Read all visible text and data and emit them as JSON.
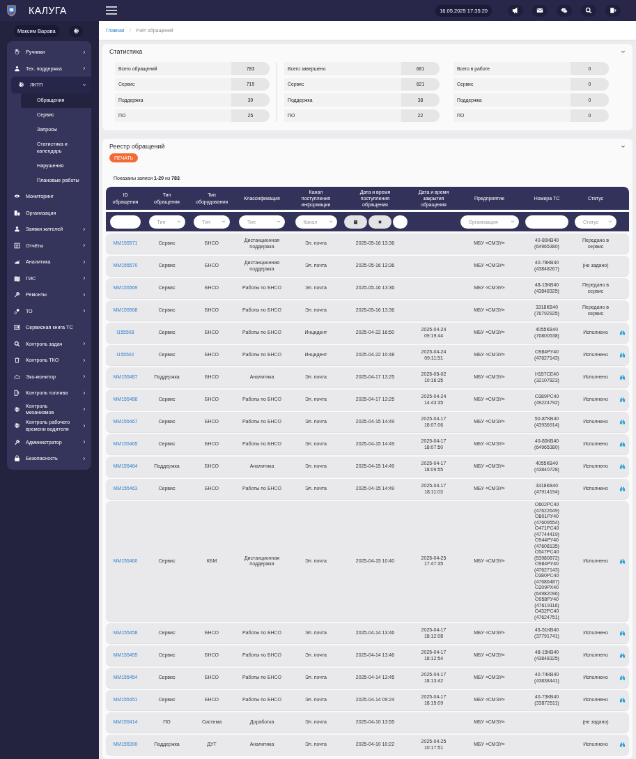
{
  "app": {
    "title": "КАЛУГА",
    "datetime": "16.05.2025 17:35:20"
  },
  "user": {
    "name": "Максим Варава"
  },
  "menu": [
    {
      "label": "Ручники",
      "submenu": true,
      "expanded": false
    },
    {
      "label": "Тех. поддержка",
      "submenu": true,
      "expanded": false
    },
    {
      "label": "ЛКТП",
      "submenu": true,
      "expanded": true,
      "children": [
        {
          "label": "Обращения",
          "selected": true
        },
        {
          "label": "Сервис",
          "selected": false
        },
        {
          "label": "Запросы",
          "selected": false
        },
        {
          "label": "Статистика и календарь",
          "selected": false
        },
        {
          "label": "Нарушения",
          "selected": false
        },
        {
          "label": "Плановые работы",
          "selected": false
        }
      ]
    },
    {
      "label": "Мониторинг",
      "submenu": false
    },
    {
      "label": "Организации",
      "submenu": false
    },
    {
      "label": "Заявки жителей",
      "submenu": true,
      "expanded": false
    },
    {
      "label": "Отчёты",
      "submenu": true,
      "expanded": false
    },
    {
      "label": "Аналитика",
      "submenu": true,
      "expanded": false
    },
    {
      "label": "ГИС",
      "submenu": true,
      "expanded": false
    },
    {
      "label": "Ремонты",
      "submenu": true,
      "expanded": false
    },
    {
      "label": "ТО",
      "submenu": true,
      "expanded": false
    },
    {
      "label": "Сервисная книга ТС",
      "submenu": false
    },
    {
      "label": "Контроль задач",
      "submenu": true,
      "expanded": false
    },
    {
      "label": "Контроль ТКО",
      "submenu": true,
      "expanded": false
    },
    {
      "label": "Эко-монитор",
      "submenu": true,
      "expanded": false
    },
    {
      "label": "Контроль топлива",
      "submenu": true,
      "expanded": false
    },
    {
      "label": "Контроль механизмов",
      "submenu": true,
      "expanded": false
    },
    {
      "label": "Контроль рабочего времени водителя",
      "submenu": true,
      "expanded": false
    },
    {
      "label": "Администратор",
      "submenu": true,
      "expanded": false
    },
    {
      "label": "Безопасность",
      "submenu": true,
      "expanded": false
    }
  ],
  "breadcrumb_separator": "/",
  "breadcrumbs": [
    {
      "label": "Главная",
      "link": true
    },
    {
      "label": "Учёт обращений",
      "link": false
    }
  ],
  "statistics": {
    "title": "Статистика",
    "groups": [
      [
        {
          "label": "Всего обращений",
          "value": "783"
        },
        {
          "label": "Сервис",
          "value": "719"
        },
        {
          "label": "Поддержка",
          "value": "39"
        },
        {
          "label": "ПО",
          "value": "25"
        }
      ],
      [
        {
          "label": "Всего завершено",
          "value": "681"
        },
        {
          "label": "Сервис",
          "value": "621"
        },
        {
          "label": "Поддержка",
          "value": "38"
        },
        {
          "label": "ПО",
          "value": "22"
        }
      ],
      [
        {
          "label": "Всего в работе",
          "value": "0"
        },
        {
          "label": "Сервис",
          "value": "0"
        },
        {
          "label": "Поддержка",
          "value": "0"
        },
        {
          "label": "ПО",
          "value": "0"
        }
      ]
    ]
  },
  "registry": {
    "title": "Реестр обращений",
    "print_button": "ПЕЧАТЬ",
    "summary": "Показаны записи **1-20** из **783**.",
    "columns": [
      "ID обращения",
      "Тип обращения",
      "Тип оборудования",
      "Классификация",
      "Канал поступления информации",
      "Дата и время поступления обращения",
      "Дата и время закрытия обращения",
      "Предприятие",
      "Номера ТС",
      "Статус"
    ],
    "filters": {
      "type": "Тип",
      "equipment": "Тип",
      "classification": "Тип",
      "channel": "Канал",
      "organization": "Организация",
      "status": "Статус"
    },
    "rows": [
      {
        "id": "MM155571",
        "type": "Сервис",
        "equipment": "БНСО",
        "classification": "Дистанционная поддержка",
        "channel": "Эл. почта",
        "received": "2025-05-16 13:36",
        "closed": "",
        "organization": "МБУ «СМЭУ»",
        "plates": [
          "40-80КВ40",
          "(64965380)"
        ],
        "status": "Передано в сервис",
        "view": false
      },
      {
        "id": "MM155570",
        "type": "Сервис",
        "equipment": "БНСО",
        "classification": "Дистанционная поддержка",
        "channel": "Эл. почта",
        "received": "2025-05-16 13:36",
        "closed": "",
        "organization": "МБУ «СМЭУ»",
        "plates": [
          "40-78КВ40",
          "(43848267)"
        ],
        "status": "(не задано)",
        "view": false
      },
      {
        "id": "MM155569",
        "type": "Сервис",
        "equipment": "БНСО",
        "classification": "Работы по БНСО",
        "channel": "Эл. почта",
        "received": "2025-05-16 13:36",
        "closed": "",
        "organization": "МБУ «СМЭУ»",
        "plates": [
          "48-15КВ40",
          "(43848325)"
        ],
        "status": "Передано в сервис",
        "view": false
      },
      {
        "id": "MM155568",
        "type": "Сервис",
        "equipment": "БНСО",
        "classification": "Работы по БНСО",
        "channel": "Эл. почта",
        "received": "2025-05-16 13:36",
        "closed": "",
        "organization": "МБУ «СМЭУ»",
        "plates": [
          "3318КВ40",
          "(76792925)"
        ],
        "status": "Передано в сервис",
        "view": false
      },
      {
        "id": "I155508",
        "type": "Сервис",
        "equipment": "БНСО",
        "classification": "Работы по БНСО",
        "channel": "Инцидент",
        "received": "2025-04-22 16:50",
        "closed": "2025-04-24 09:19:44",
        "organization": "МБУ «СМЭУ»",
        "plates": [
          "4055КВ40",
          "(76800538)"
        ],
        "status": "Исполнено",
        "view": true
      },
      {
        "id": "I155502",
        "type": "Сервис",
        "equipment": "БНСО",
        "classification": "Работы по БНСО",
        "channel": "Инцидент",
        "received": "2025-04-22 10:48",
        "closed": "2025-04-24 09:11:51",
        "organization": "МБУ «СМЭУ»",
        "plates": [
          "О984РУ40",
          "(47627143)"
        ],
        "status": "Исполнено",
        "view": true
      },
      {
        "id": "MM155487",
        "type": "Поддержка",
        "equipment": "БНСО",
        "classification": "Аналитика",
        "channel": "Эл. почта",
        "received": "2025-04-17 13:25",
        "closed": "2025-05-02 10:16:35",
        "organization": "МБУ «СМЭУ»",
        "plates": [
          "Н157СЕ40",
          "(32107823)"
        ],
        "status": "Исполнено",
        "view": true
      },
      {
        "id": "MM155486",
        "type": "Сервис",
        "equipment": "БНСО",
        "classification": "Работы по БНСО",
        "channel": "Эл. почта",
        "received": "2025-04-17 13:25",
        "closed": "2025-04-24 14:43:35",
        "organization": "МБУ «СМЭУ»",
        "plates": [
          "О389РС40",
          "(49224792)"
        ],
        "status": "Исполнено",
        "view": true
      },
      {
        "id": "MM155467",
        "type": "Сервис",
        "equipment": "БНСО",
        "classification": "Работы по БНСО",
        "channel": "Эл. почта",
        "received": "2025-04-15 14:49",
        "closed": "2025-04-17 18:07:06",
        "organization": "МБУ «СМЭУ»",
        "plates": [
          "50-87КВ40",
          "(43936914)"
        ],
        "status": "Исполнено",
        "view": true
      },
      {
        "id": "MM155465",
        "type": "Сервис",
        "equipment": "БНСО",
        "classification": "Работы по БНСО",
        "channel": "Эл. почта",
        "received": "2025-04-15 14:49",
        "closed": "2025-04-17 18:07:50",
        "organization": "МБУ «СМЭУ»",
        "plates": [
          "40-80КВ40",
          "(64965380)"
        ],
        "status": "Исполнено",
        "view": true
      },
      {
        "id": "MM155464",
        "type": "Поддержка",
        "equipment": "БНСО",
        "classification": "Аналитика",
        "channel": "Эл. почта",
        "received": "2025-04-15 14:49",
        "closed": "2025-04-17 18:09:55",
        "organization": "МБУ «СМЭУ»",
        "plates": [
          "4055КВ40",
          "(43840728)"
        ],
        "status": "Исполнено",
        "view": true
      },
      {
        "id": "MM155463",
        "type": "Сервис",
        "equipment": "БНСО",
        "classification": "Работы по БНСО",
        "channel": "Эл. почта",
        "received": "2025-04-15 14:49",
        "closed": "2025-04-17 18:11:03",
        "organization": "МБУ «СМЭУ»",
        "plates": [
          "3318КВ40",
          "(47914194)"
        ],
        "status": "Исполнено",
        "view": true
      },
      {
        "id": "MM155460",
        "type": "Сервис",
        "equipment": "КБМ",
        "classification": "Дистанционная поддержка",
        "channel": "Эл. почта",
        "received": "2025-04-15 10:40",
        "closed": "2025-04-25 17:47:35",
        "organization": "МБУ «СМЭУ»",
        "plates": [
          "О602РС40",
          "(47622649)",
          "О801РУ40",
          "(47609554)",
          "О471РС40",
          "(47744419)",
          "О944РУ40",
          "(47608135)",
          "О547РС40",
          "(53980872)",
          "О984РУ40",
          "(47627143)",
          "О380РС40",
          "(47686487)",
          "О209РХ40",
          "(64982096)",
          "О958РУ40",
          "(47619116)",
          "О432РС40",
          "(47624751)"
        ],
        "status": "Исполнено",
        "view": true
      },
      {
        "id": "MM155458",
        "type": "Сервис",
        "equipment": "БНСО",
        "classification": "Работы по БНСО",
        "channel": "Эл. почта",
        "received": "2025-04-14 13:46",
        "closed": "2025-04-17 18:12:08",
        "organization": "МБУ «СМЭУ»",
        "plates": [
          "45-51КВ40",
          "(37791741)"
        ],
        "status": "Исполнено",
        "view": true
      },
      {
        "id": "MM155455",
        "type": "Сервис",
        "equipment": "БНСО",
        "classification": "Работы по БНСО",
        "channel": "Эл. почта",
        "received": "2025-04-14 13:46",
        "closed": "2025-04-17 18:12:54",
        "organization": "МБУ «СМЭУ»",
        "plates": [
          "48-15КВ40",
          "(43848325)"
        ],
        "status": "Исполнено",
        "view": true
      },
      {
        "id": "MM155454",
        "type": "Сервис",
        "equipment": "БНСО",
        "classification": "Работы по БНСО",
        "channel": "Эл. почта",
        "received": "2025-04-14 13:45",
        "closed": "2025-04-17 18:13:42",
        "organization": "МБУ «СМЭУ»",
        "plates": [
          "40-74КВ40",
          "(43838441)"
        ],
        "status": "Исполнено",
        "view": true
      },
      {
        "id": "MM155451",
        "type": "Сервис",
        "equipment": "БНСО",
        "classification": "Работы по БНСО",
        "channel": "Эл. почта",
        "received": "2025-04-14 09:24",
        "closed": "2025-04-17 18:15:09",
        "organization": "МБУ «СМЭУ»",
        "plates": [
          "40-73КВ40",
          "(33872511)"
        ],
        "status": "Исполнено",
        "view": true
      },
      {
        "id": "MM155414",
        "type": "ПО",
        "equipment": "Система",
        "classification": "Доработка",
        "channel": "Эл. почта",
        "received": "2025-04-10 13:55",
        "closed": "",
        "organization": "МБУ «СМЭУ»",
        "plates": [],
        "status": "(не задано)",
        "view": false
      },
      {
        "id": "MM155390",
        "type": "Поддержка",
        "equipment": "ДУТ",
        "classification": "Аналитика",
        "channel": "Эл. почта",
        "received": "2025-04-10 10:22",
        "closed": "2025-04-25 10:17:51",
        "organization": "МБУ «СМЭУ»",
        "plates": [],
        "status": "Исполнено",
        "view": true
      }
    ]
  }
}
